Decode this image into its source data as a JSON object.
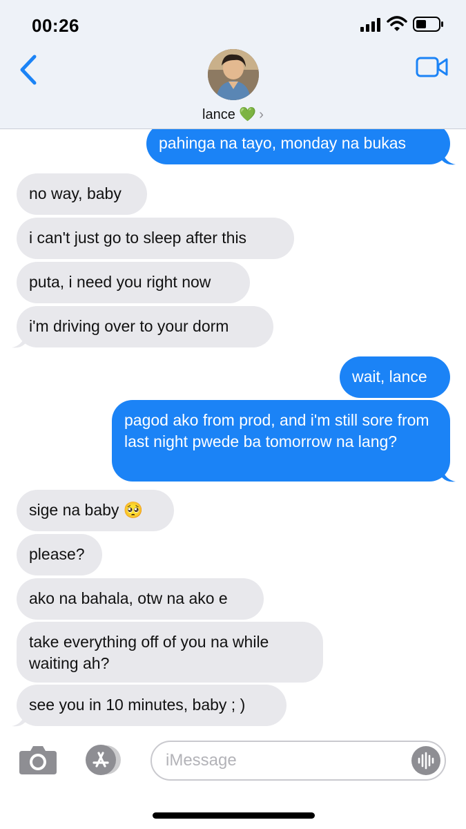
{
  "status": {
    "time": "00:26"
  },
  "header": {
    "contact_name": "lance 💚",
    "chevron": "›"
  },
  "messages": [
    {
      "dir": "out",
      "text": "pahinga na tayo, monday na bukas"
    },
    {
      "dir": "in",
      "text": "no way, baby"
    },
    {
      "dir": "in",
      "text": "i can't just go to sleep after this"
    },
    {
      "dir": "in",
      "text": "puta, i need you right now"
    },
    {
      "dir": "in",
      "text": "i'm driving over to your dorm"
    },
    {
      "dir": "out",
      "text": "wait, lance"
    },
    {
      "dir": "out",
      "text": "pagod ako from prod, and i'm still sore from last night pwede ba tomorrow na lang?"
    },
    {
      "dir": "in",
      "text": "sige na baby 🥺"
    },
    {
      "dir": "in",
      "text": "please?"
    },
    {
      "dir": "in",
      "text": "ako na bahala, otw na ako e"
    },
    {
      "dir": "in",
      "text": "take everything off of you na while waiting ah?"
    },
    {
      "dir": "in",
      "text": "see you in 10 minutes, baby ; )"
    }
  ],
  "composer": {
    "placeholder": "iMessage"
  },
  "colors": {
    "outgoing": "#1b83f6",
    "incoming": "#e8e8ec",
    "accent": "#1b83f6"
  },
  "icons": [
    "back-chevron-icon",
    "video-call-icon",
    "camera-icon",
    "app-store-icon",
    "audio-waveform-icon",
    "signal-icon",
    "wifi-icon",
    "battery-icon"
  ]
}
